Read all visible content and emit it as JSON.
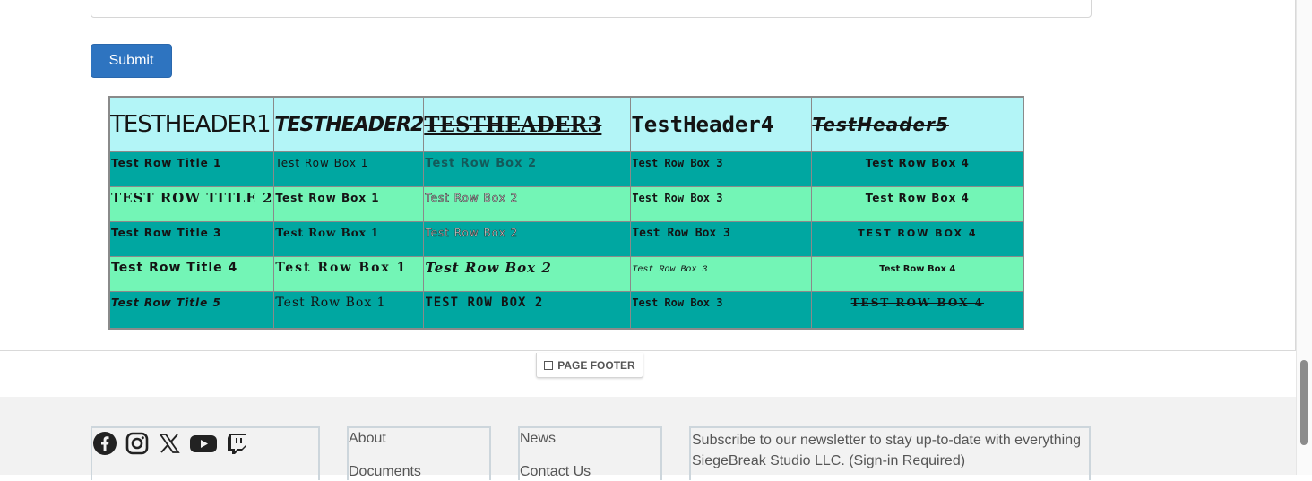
{
  "form": {
    "submit_label": "Submit"
  },
  "test_table": {
    "headers": [
      "TESTHEADER1",
      "TESTHEADER2",
      "TESTHEADER3",
      "TestHeader4",
      "TestHeader5"
    ],
    "rows": [
      [
        "Test Row Title 1",
        "Test Row Box 1",
        "Test Row Box 2",
        "Test Row Box 3",
        "Test Row Box 4"
      ],
      [
        "TEST ROW TITLE 2",
        "Test Row Box 1",
        "Test Row Box 2",
        "Test Row Box 3",
        "Test Row Box 4"
      ],
      [
        "Test Row Title 3",
        "Test Row Box 1",
        "Test Row Box 2",
        "Test Row Box 3",
        "TEST ROW BOX 4"
      ],
      [
        "Test Row Title 4",
        "Test Row Box 1",
        "Test Row Box 2",
        "Test Row Box 3",
        "Test Row Box 4"
      ],
      [
        "Test Row Title 5",
        "Test Row Box 1",
        "TEST ROW BOX 2",
        "Test Row Box 3",
        "TEST ROW BOX 4"
      ]
    ],
    "colors": {
      "header_bg": "#b3f5f7",
      "dark_row": "#00a7a1",
      "light_row": "#73f5b6"
    }
  },
  "page_footer_tab": {
    "label": "PAGE FOOTER",
    "icon": "square-icon"
  },
  "footer": {
    "social_icons": [
      "facebook-icon",
      "instagram-icon",
      "x-icon",
      "youtube-icon",
      "twitch-icon"
    ],
    "links_col1": [
      "About",
      "Documents"
    ],
    "links_col2": [
      "News",
      "Contact Us"
    ],
    "newsletter_text": "Subscribe to our newsletter to stay up-to-date with everything SiegeBreak Studio LLC. (Sign-in Required)"
  }
}
